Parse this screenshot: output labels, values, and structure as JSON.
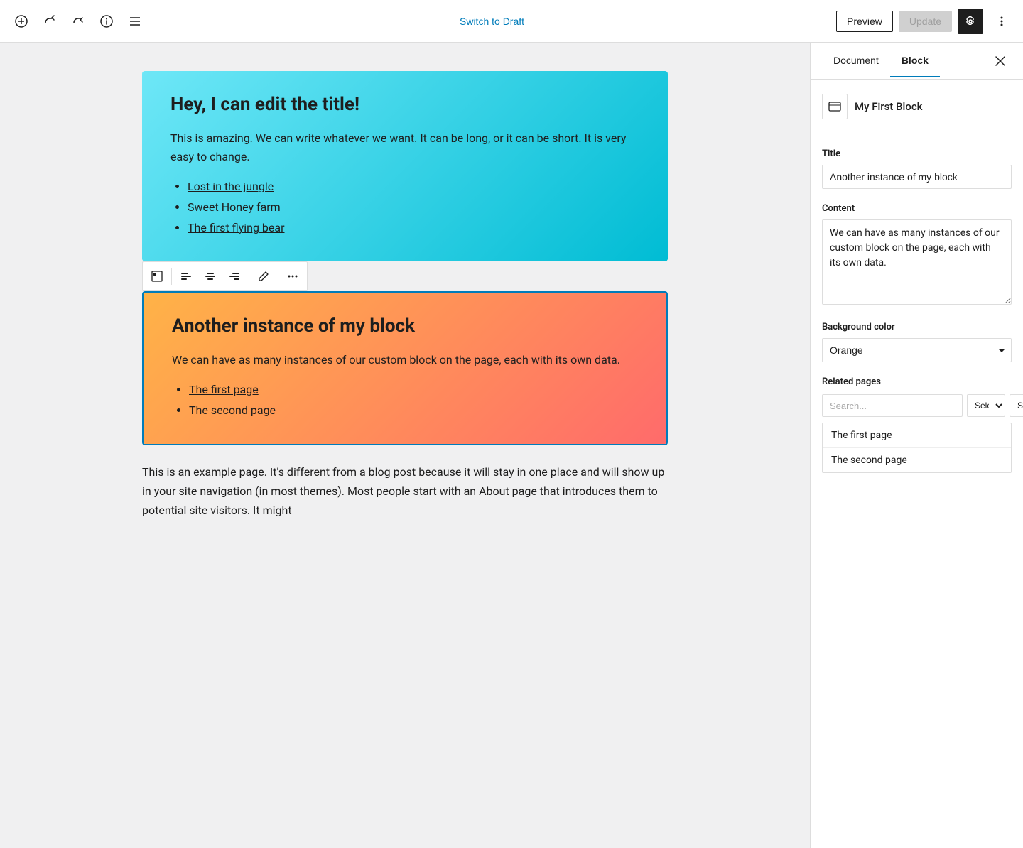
{
  "toolbar": {
    "switch_to_draft": "Switch to Draft",
    "preview": "Preview",
    "update": "Update"
  },
  "sidebar": {
    "tab_document": "Document",
    "tab_block": "Block",
    "block_name": "My First Block",
    "fields": {
      "title_label": "Title",
      "title_value": "Another instance of my block",
      "content_label": "Content",
      "content_value": "We can have as many instances of our custom block on the page, each with its own data.",
      "bg_color_label": "Background color",
      "bg_color_value": "Orange",
      "related_pages_label": "Related pages",
      "search_placeholder": "Search...",
      "select1_label": "Sele",
      "select2_label": "Sele"
    },
    "related_pages": [
      "The first page",
      "The second page"
    ]
  },
  "editor": {
    "block1": {
      "title": "Hey, I can edit the title!",
      "body": "This is amazing. We can write whatever we want. It can be long, or it can be short. It is very easy to change.",
      "list_items": [
        "Lost in the jungle",
        "Sweet Honey farm",
        "The first flying bear"
      ]
    },
    "block2": {
      "title": "Another instance of my block",
      "body": "We can have as many instances of our custom block on the page, each with its own data.",
      "list_items": [
        "The first page",
        "The second page"
      ]
    },
    "text_block": "This is an example page. It's different from a blog post because it will stay in one place and will show up in your site navigation (in most themes). Most people start with an About page that introduces them to potential site visitors. It might"
  }
}
